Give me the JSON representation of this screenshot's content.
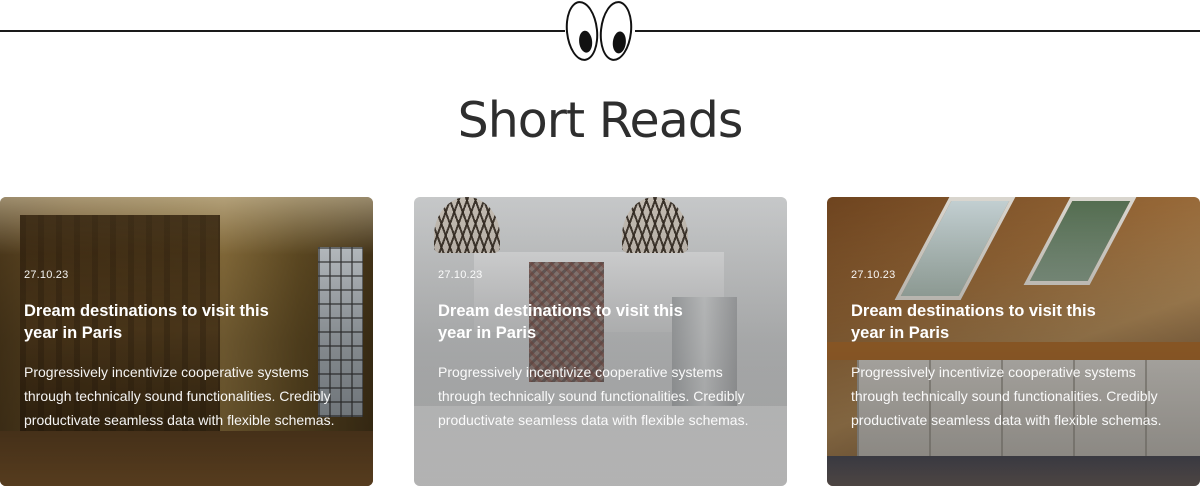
{
  "section": {
    "title": "Short Reads"
  },
  "decor": {
    "eyes_icon": "eyes-icon",
    "line_color": "#1a1a1a"
  },
  "cards": [
    {
      "date": "27.10.23",
      "title": "Dream destinations to visit this year in Paris",
      "excerpt": "Progressively incentivize cooperative systems through technically sound functionalities. Credibly productivate seamless data with flexible schemas."
    },
    {
      "date": "27.10.23",
      "title": "Dream destinations to visit this year in Paris",
      "excerpt": "Progressively incentivize cooperative systems through technically sound functionalities. Credibly productivate seamless data with flexible schemas."
    },
    {
      "date": "27.10.23",
      "title": "Dream destinations to visit this year in Paris",
      "excerpt": "Progressively incentivize cooperative systems through technically sound functionalities. Credibly productivate seamless data with flexible schemas."
    }
  ]
}
